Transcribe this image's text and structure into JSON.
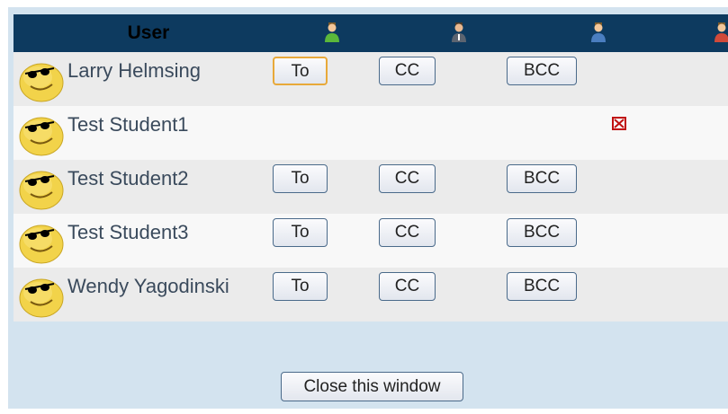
{
  "header": {
    "user_label": "User",
    "role_icons": [
      "participant-green-icon",
      "participant-gray-icon",
      "participant-blue-icon",
      "participant-red-icon"
    ]
  },
  "rows": [
    {
      "name": "Larry Helmsing",
      "buttons": {
        "to": "To",
        "cc": "CC",
        "bcc": "BCC"
      },
      "focused": "To"
    },
    {
      "name": "Test Student1",
      "status_icon": "red-x-icon"
    },
    {
      "name": "Test Student2",
      "buttons": {
        "to": "To",
        "cc": "CC",
        "bcc": "BCC"
      }
    },
    {
      "name": "Test Student3",
      "buttons": {
        "to": "To",
        "cc": "CC",
        "bcc": "BCC"
      }
    },
    {
      "name": "Wendy Yagodinski",
      "buttons": {
        "to": "To",
        "cc": "CC",
        "bcc": "BCC"
      }
    }
  ],
  "footer": {
    "close_label": "Close this window"
  },
  "colors": {
    "header_bg": "#0d3a5f",
    "panel_bg": "#d3e3ef",
    "row_odd": "#ebebeb",
    "row_even": "#f8f8f8",
    "focus_border": "#e8a93a"
  }
}
